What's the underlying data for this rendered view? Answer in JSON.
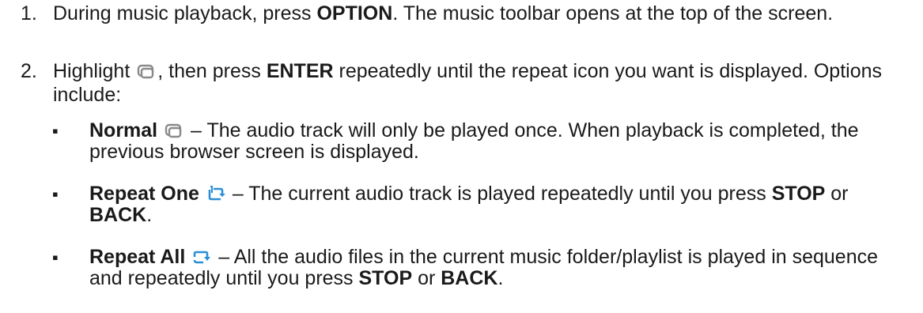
{
  "steps": [
    {
      "number": "1.",
      "text_before": "During music playback, press ",
      "bold": "OPTION",
      "text_after": ". The music toolbar opens at the top of the screen."
    },
    {
      "number": "2.",
      "text_a": "Highlight ",
      "text_b": ", then press ",
      "bold": "ENTER",
      "text_c": " repeatedly until the repeat icon you want is displayed. Options include:",
      "icon": "repeat-normal-icon"
    }
  ],
  "options": [
    {
      "bullet": "▪",
      "name": "Normal",
      "icon": "repeat-normal-icon",
      "description": " – The audio track will only be played once. When playback is completed, the previous browser screen is displayed."
    },
    {
      "bullet": "▪",
      "name": "Repeat One",
      "icon": "repeat-one-icon",
      "description": " – The current audio track is played repeatedly until you press ",
      "key1": "STOP",
      "or": " or ",
      "key2": "BACK",
      "end": "."
    },
    {
      "bullet": "▪",
      "name": "Repeat All",
      "icon": "repeat-all-icon",
      "description": " – All the audio files in the current music folder/playlist is played in sequence and repeatedly until you press ",
      "key1": "STOP",
      "or": " or ",
      "key2": "BACK",
      "end": "."
    }
  ],
  "colors": {
    "text": "#1a1a1a",
    "icon_gray": "#8a8a8a",
    "icon_blue": "#2b8fd6"
  }
}
